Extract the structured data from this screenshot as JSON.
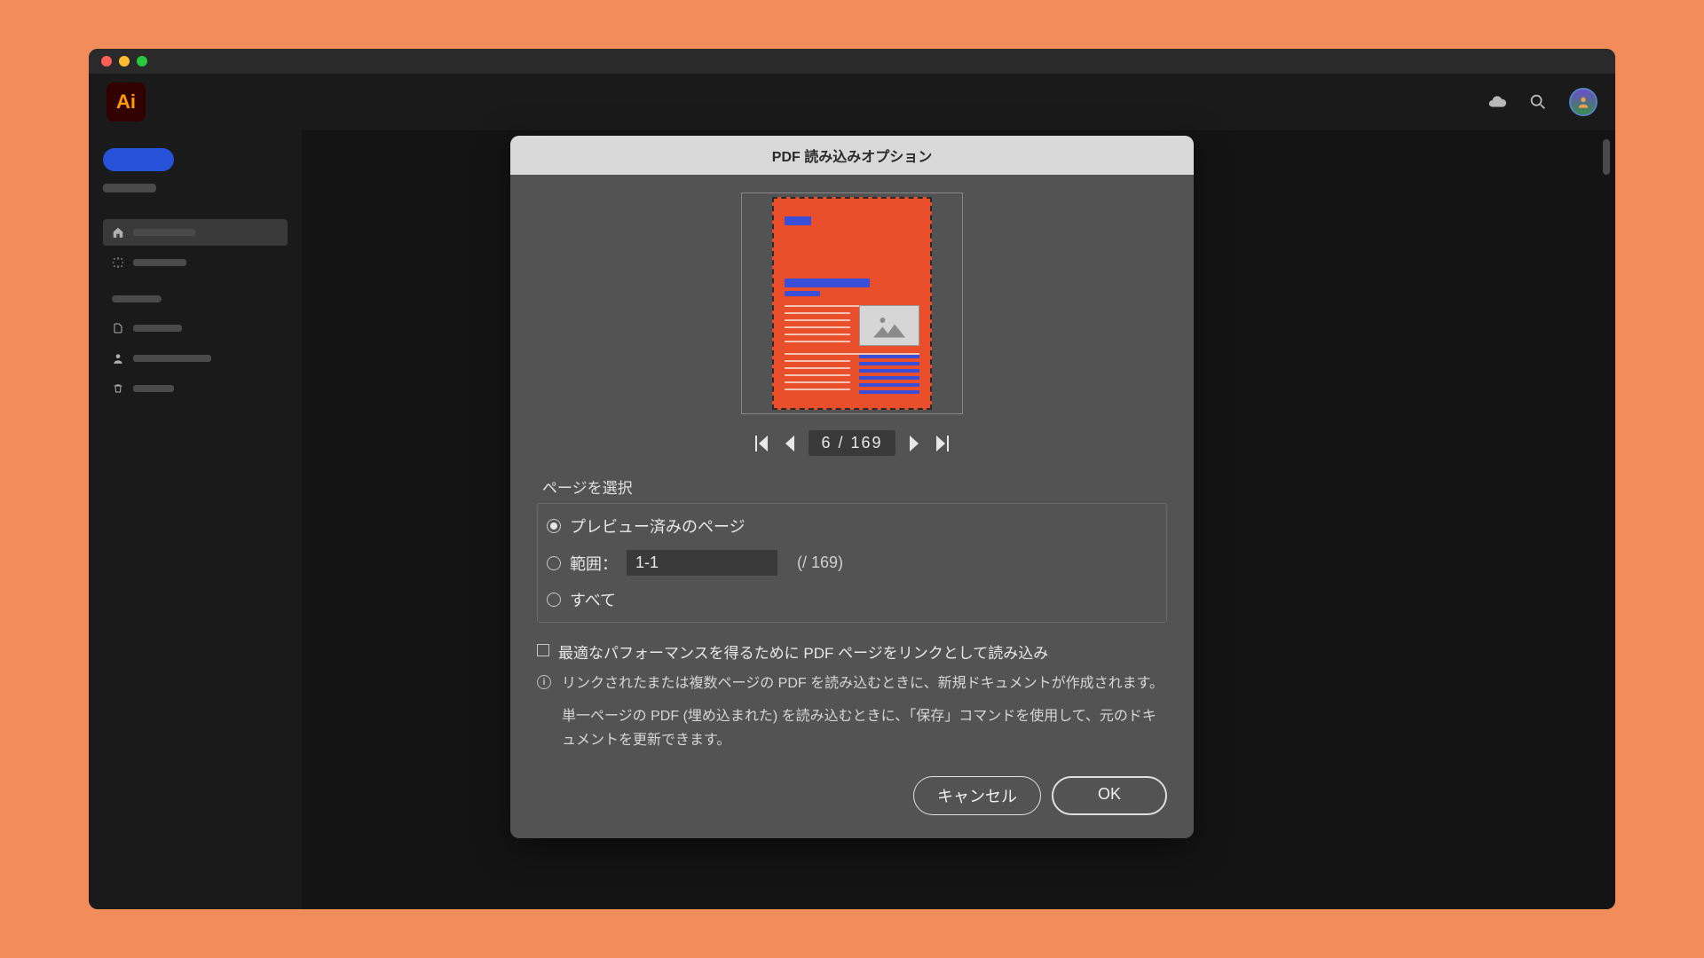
{
  "app": {
    "logo_text": "Ai"
  },
  "dialog": {
    "title": "PDF 読み込みオプション",
    "pager": {
      "current": "6",
      "sep": "/",
      "total": "169"
    },
    "section_label": "ページを選択",
    "options": {
      "previewed": "プレビュー済みのページ",
      "range_label": "範囲：",
      "range_value": "1-1",
      "range_total": "(/ 169)",
      "all": "すべて"
    },
    "checkbox_label": "最適なパフォーマンスを得るために PDF ページをリンクとして読み込み",
    "info1": "リンクされたまたは複数ページの PDF を読み込むときに、新規ドキュメントが作成されます。",
    "info2": "単一ページの PDF (埋め込まれた) を読み込むときに、「保存」コマンドを使用して、元のドキュメントを更新できます。",
    "cancel": "キャンセル",
    "ok": "OK"
  }
}
